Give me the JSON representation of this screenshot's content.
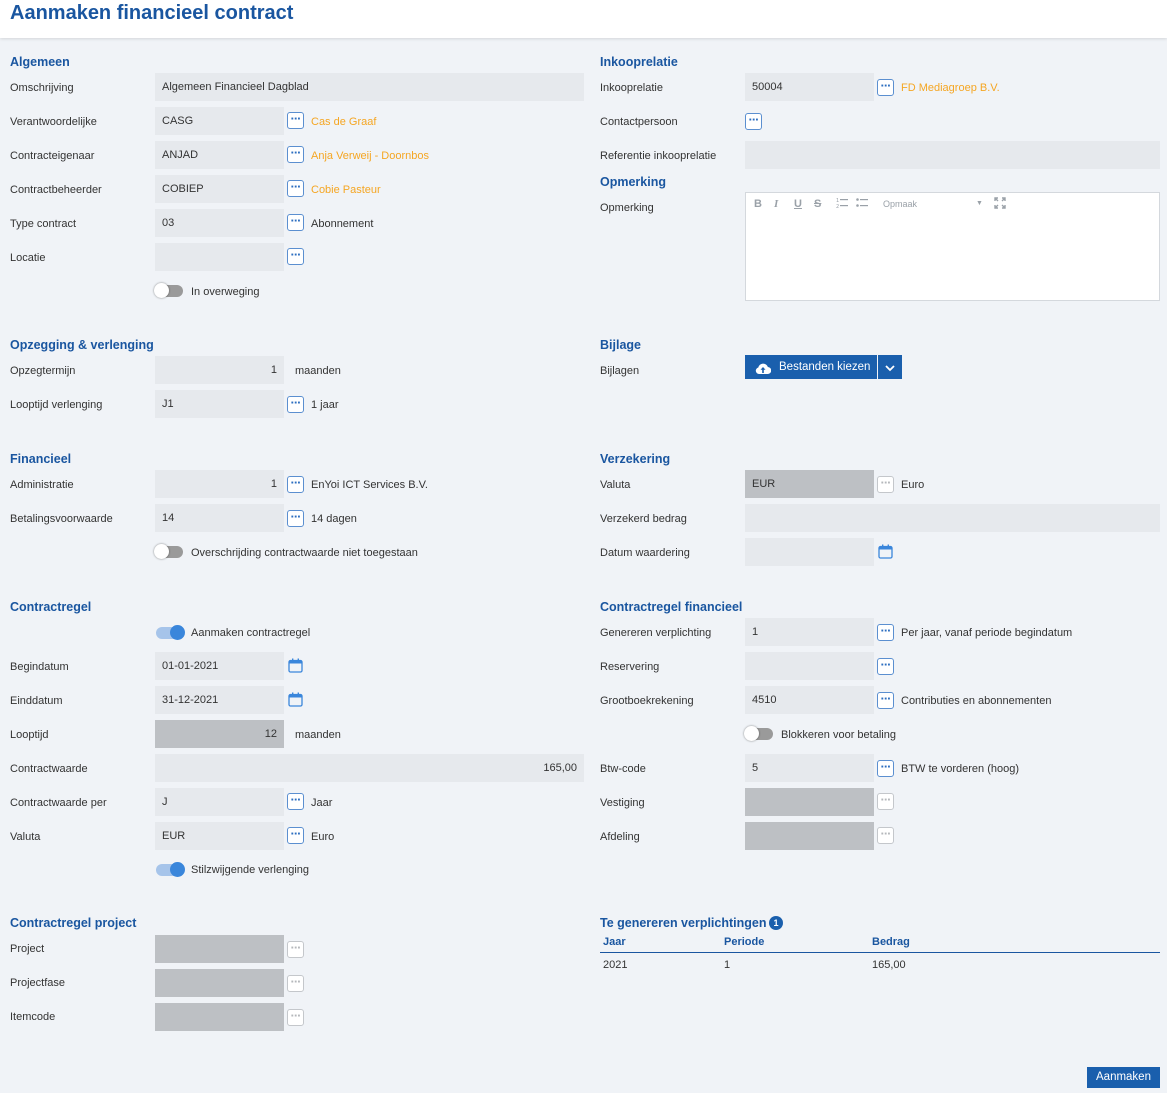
{
  "title": "Aanmaken financieel contract",
  "algemeen": {
    "heading": "Algemeen",
    "omschrijving": {
      "label": "Omschrijving",
      "value": "Algemeen Financieel Dagblad"
    },
    "verantwoordelijke": {
      "label": "Verantwoordelijke",
      "value": "CASG",
      "name": "Cas de Graaf"
    },
    "contracteigenaar": {
      "label": "Contracteigenaar",
      "value": "ANJAD",
      "name": "Anja Verweij - Doornbos"
    },
    "contractbeheerder": {
      "label": "Contractbeheerder",
      "value": "COBIEP",
      "name": "Cobie Pasteur"
    },
    "type_contract": {
      "label": "Type contract",
      "value": "03",
      "name": "Abonnement"
    },
    "locatie": {
      "label": "Locatie",
      "value": ""
    },
    "in_overweging": {
      "label": "In overweging",
      "on": false
    }
  },
  "inkooprelatie": {
    "heading": "Inkooprelatie",
    "inkooprelatie": {
      "label": "Inkooprelatie",
      "value": "50004",
      "name": "FD Mediagroep B.V."
    },
    "contactpersoon": {
      "label": "Contactpersoon"
    },
    "referentie": {
      "label": "Referentie inkooprelatie",
      "value": ""
    }
  },
  "opmerking": {
    "heading": "Opmerking",
    "label": "Opmerking",
    "toolbar": {
      "bold": "B",
      "italic": "I",
      "underline": "U",
      "strike": "S",
      "format": "Opmaak"
    }
  },
  "opzegging": {
    "heading": "Opzegging & verlenging",
    "opzegtermijn": {
      "label": "Opzegtermijn",
      "value": "1",
      "unit": "maanden"
    },
    "looptijd_verlenging": {
      "label": "Looptijd verlenging",
      "value": "J1",
      "name": "1 jaar"
    }
  },
  "bijlage": {
    "heading": "Bijlage",
    "label": "Bijlagen",
    "button": "Bestanden kiezen"
  },
  "financieel": {
    "heading": "Financieel",
    "administratie": {
      "label": "Administratie",
      "value": "1",
      "name": "EnYoi ICT Services B.V."
    },
    "betalingsvoorwaarde": {
      "label": "Betalingsvoorwaarde",
      "value": "14",
      "name": "14 dagen"
    },
    "overschrijding": {
      "label": "Overschrijding contractwaarde niet toegestaan",
      "on": false
    }
  },
  "verzekering": {
    "heading": "Verzekering",
    "valuta": {
      "label": "Valuta",
      "value": "EUR",
      "name": "Euro"
    },
    "verzekerd_bedrag": {
      "label": "Verzekerd bedrag",
      "value": ""
    },
    "datum_waardering": {
      "label": "Datum waardering",
      "value": ""
    }
  },
  "contractregel": {
    "heading": "Contractregel",
    "aanmaken": {
      "label": "Aanmaken contractregel",
      "on": true
    },
    "begindatum": {
      "label": "Begindatum",
      "value": "01-01-2021"
    },
    "einddatum": {
      "label": "Einddatum",
      "value": "31-12-2021"
    },
    "looptijd": {
      "label": "Looptijd",
      "value": "12",
      "unit": "maanden"
    },
    "contractwaarde": {
      "label": "Contractwaarde",
      "value": "165,00"
    },
    "contractwaarde_per": {
      "label": "Contractwaarde per",
      "value": "J",
      "name": "Jaar"
    },
    "valuta": {
      "label": "Valuta",
      "value": "EUR",
      "name": "Euro"
    },
    "stilzwijgend": {
      "label": "Stilzwijgende verlenging",
      "on": true
    }
  },
  "contractregel_financieel": {
    "heading": "Contractregel financieel",
    "genereren": {
      "label": "Genereren verplichting",
      "value": "1",
      "name": "Per jaar, vanaf periode begindatum"
    },
    "reservering": {
      "label": "Reservering",
      "value": ""
    },
    "grootboek": {
      "label": "Grootboekrekening",
      "value": "4510",
      "name": "Contributies en abonnementen"
    },
    "blokkeren": {
      "label": "Blokkeren voor betaling",
      "on": false
    },
    "btw": {
      "label": "Btw-code",
      "value": "5",
      "name": "BTW te vorderen (hoog)"
    },
    "vestiging": {
      "label": "Vestiging",
      "value": ""
    },
    "afdeling": {
      "label": "Afdeling",
      "value": ""
    }
  },
  "project": {
    "heading": "Contractregel project",
    "project": {
      "label": "Project"
    },
    "projectfase": {
      "label": "Projectfase"
    },
    "itemcode": {
      "label": "Itemcode"
    }
  },
  "verplichtingen": {
    "heading": "Te genereren verplichtingen",
    "count": "1",
    "columns": [
      "Jaar",
      "Periode",
      "Bedrag"
    ],
    "rows": [
      [
        "2021",
        "1",
        "165,00"
      ]
    ]
  },
  "submit": "Aanmaken",
  "colors": {
    "primary": "#1a56a0",
    "button": "#1a5fad",
    "link": "#f5a623",
    "field": "#e6e9ed",
    "disabled": "#bdc0c4"
  }
}
